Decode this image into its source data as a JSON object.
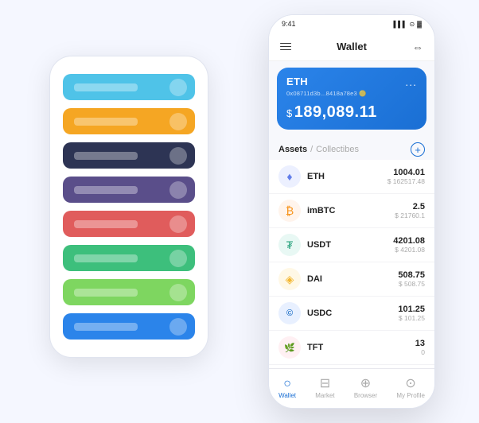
{
  "bgPhone": {
    "cards": [
      {
        "color": "#4fc3e8",
        "label": "card-1"
      },
      {
        "color": "#f5a623",
        "label": "card-2"
      },
      {
        "color": "#2d3454",
        "label": "card-3"
      },
      {
        "color": "#5a4e8a",
        "label": "card-4"
      },
      {
        "color": "#e05c5c",
        "label": "card-5"
      },
      {
        "color": "#3dbf7c",
        "label": "card-6"
      },
      {
        "color": "#7ed660",
        "label": "card-7"
      },
      {
        "color": "#2b84ea",
        "label": "card-8"
      }
    ]
  },
  "fgPhone": {
    "statusBar": {
      "time": "9:41",
      "signal": "▌▌▌",
      "wifi": "▲",
      "battery": "▓"
    },
    "nav": {
      "title": "Wallet",
      "expandIcon": "⇔"
    },
    "ethCard": {
      "title": "ETH",
      "dotsLabel": "...",
      "address": "0x08711d3b...8418a78e3 🟡",
      "balancePrefix": "$",
      "balance": "189,089.11"
    },
    "tabs": {
      "active": "Assets",
      "separator": "/",
      "inactive": "Collectibes",
      "addLabel": "+"
    },
    "assets": [
      {
        "id": "eth",
        "name": "ETH",
        "amount": "1004.01",
        "usd": "$ 162517.48",
        "iconClass": "icon-eth",
        "iconChar": "♦"
      },
      {
        "id": "imbtc",
        "name": "imBTC",
        "amount": "2.5",
        "usd": "$ 21760.1",
        "iconClass": "icon-imbtc",
        "iconChar": "₿"
      },
      {
        "id": "usdt",
        "name": "USDT",
        "amount": "4201.08",
        "usd": "$ 4201.08",
        "iconClass": "icon-usdt",
        "iconChar": "₮"
      },
      {
        "id": "dai",
        "name": "DAI",
        "amount": "508.75",
        "usd": "$ 508.75",
        "iconClass": "icon-dai",
        "iconChar": "◈"
      },
      {
        "id": "usdc",
        "name": "USDC",
        "amount": "101.25",
        "usd": "$ 101.25",
        "iconClass": "icon-usdc",
        "iconChar": "©"
      },
      {
        "id": "tft",
        "name": "TFT",
        "amount": "13",
        "usd": "0",
        "iconClass": "icon-tft",
        "iconChar": "🌿"
      }
    ],
    "bottomNav": [
      {
        "id": "wallet",
        "label": "Wallet",
        "icon": "○",
        "active": true
      },
      {
        "id": "market",
        "label": "Market",
        "icon": "⊟",
        "active": false
      },
      {
        "id": "browser",
        "label": "Browser",
        "icon": "⊕",
        "active": false
      },
      {
        "id": "my-profile",
        "label": "My Profile",
        "icon": "⊙",
        "active": false
      }
    ]
  }
}
